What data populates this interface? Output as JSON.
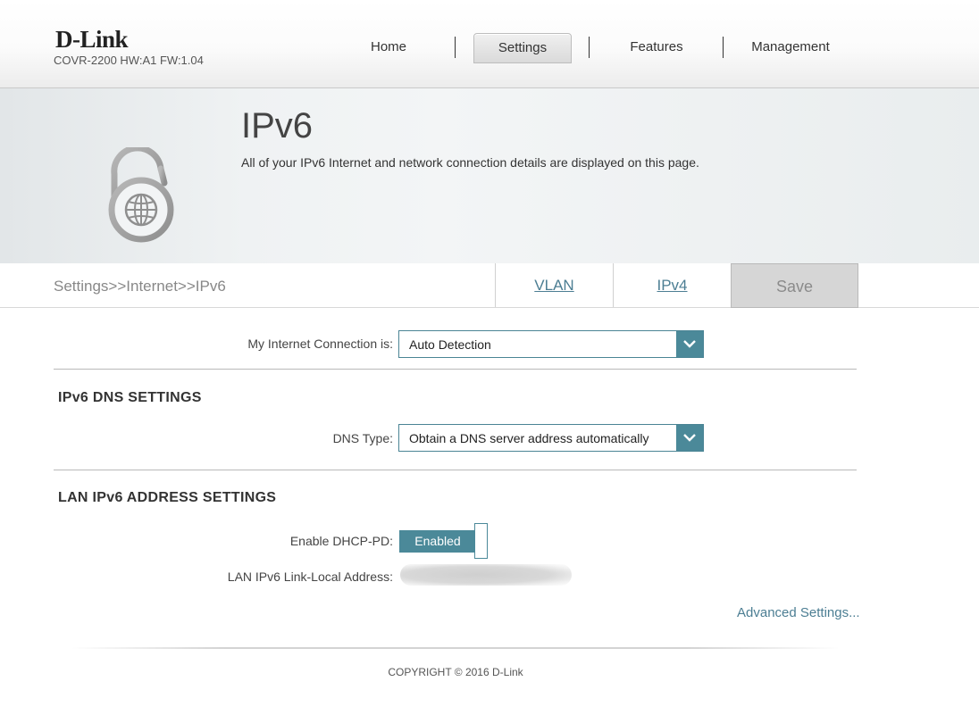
{
  "header": {
    "logo": "D-Link",
    "model_info": "COVR-2200 HW:A1 FW:1.04",
    "nav": [
      {
        "label": "Home",
        "active": false
      },
      {
        "label": "Settings",
        "active": true
      },
      {
        "label": "Features",
        "active": false
      },
      {
        "label": "Management",
        "active": false
      }
    ]
  },
  "banner": {
    "title": "IPv6",
    "description": "All of your IPv6 Internet and network connection details are displayed on this page.",
    "icon": "padlock-globe-icon"
  },
  "tabbar": {
    "breadcrumb": "Settings>>Internet>>IPv6",
    "tabs": [
      "VLAN",
      "IPv4"
    ],
    "save_label": "Save"
  },
  "connection": {
    "label": "My Internet Connection is:",
    "value": "Auto Detection"
  },
  "dns_section": {
    "title": "IPv6 DNS SETTINGS",
    "dns_type_label": "DNS Type:",
    "dns_type_value": "Obtain a DNS server address automatically"
  },
  "lan_section": {
    "title": "LAN IPv6 ADDRESS SETTINGS",
    "dhcp_pd_label": "Enable DHCP-PD:",
    "dhcp_pd_value": "Enabled",
    "link_local_label": "LAN IPv6 Link-Local Address:",
    "advanced_link": "Advanced Settings..."
  },
  "footer": {
    "copyright": "COPYRIGHT © 2016 D-Link"
  },
  "colors": {
    "accent": "#4b8999",
    "link": "#4c7e93",
    "save_bg": "#d6d6d6"
  }
}
